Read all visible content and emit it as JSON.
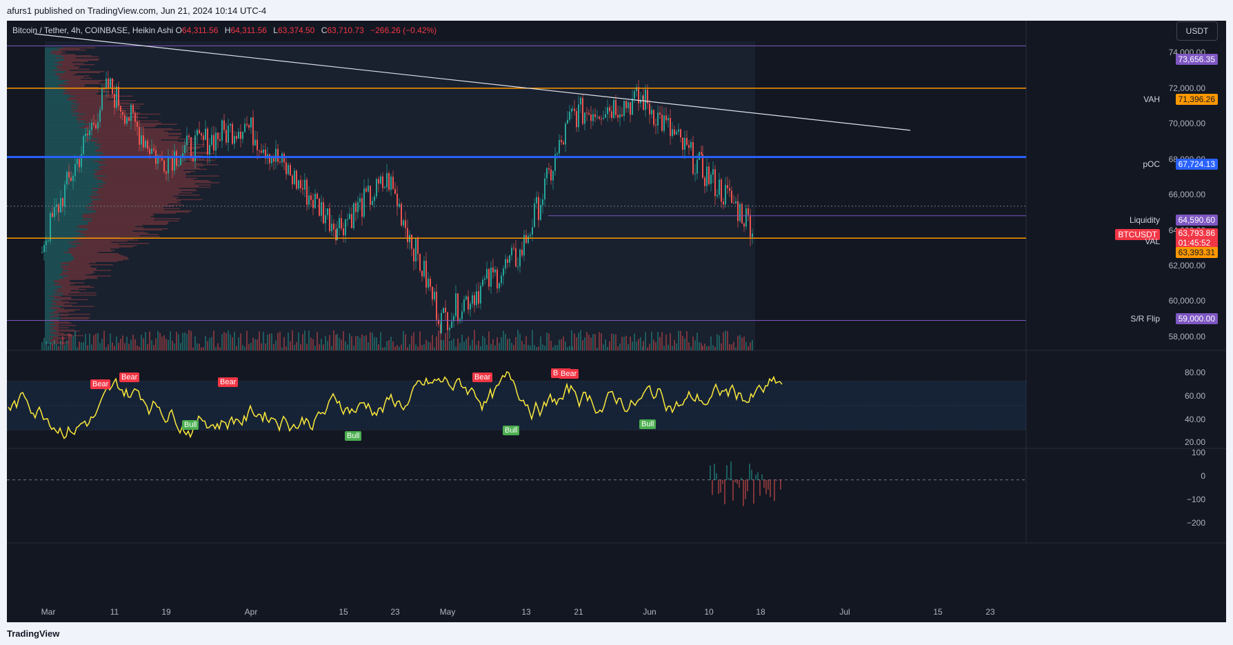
{
  "header": {
    "published": "afurs1 published on TradingView.com, Jun 21, 2024 10:14 UTC-4"
  },
  "legend": {
    "symbol": "Bitcoin / Tether, 4h, COINBASE, Heikin Ashi",
    "o_label": "O",
    "o": "64,311.56",
    "h_label": "H",
    "h": "64,311.56",
    "l_label": "L",
    "l": "63,374.50",
    "c_label": "C",
    "c": "63,710.73",
    "change": "−266.26 (−0.42%)"
  },
  "currency": "USDT",
  "levels": {
    "resistance_top": "73,656.35",
    "vah_label": "VAH",
    "vah": "71,396.26",
    "poc_label": "pOC",
    "poc": "67,724.13",
    "liquidity_label": "Liquidity",
    "liquidity": "64,590.60",
    "symbol_tag": "BTCUSDT",
    "last_price": "63,793.86",
    "countdown": "01:45:52",
    "val_label": "VAL",
    "val": "63,393.31",
    "sr_label": "S/R Flip",
    "sr": "59,000.00"
  },
  "colors": {
    "bg": "#131722",
    "up": "#26a69a",
    "down": "#ef5350",
    "vah": "#ff9800",
    "poc": "#2962ff",
    "purple": "#7e57c2",
    "osc": "#ffeb3b"
  },
  "price_axis": [
    "74,000.00",
    "72,000.00",
    "70,000.00",
    "68,000.00",
    "66,000.00",
    "64,000.00",
    "62,000.00",
    "60,000.00",
    "58,000.00"
  ],
  "osc_axis": [
    "80.00",
    "60.00",
    "40.00",
    "20.00"
  ],
  "cvd_axis": [
    "100",
    "0",
    "−100",
    "−200"
  ],
  "time_axis": [
    "Mar",
    "11",
    "19",
    "Apr",
    "15",
    "23",
    "May",
    "13",
    "21",
    "Jun",
    "10",
    "18",
    "Jul",
    "15",
    "23"
  ],
  "signals": {
    "bear": "Bear",
    "bull": "Bull"
  },
  "footer": {
    "brand": "TradingView"
  },
  "chart_data": {
    "type": "candlestick",
    "symbol": "BTCUSDT",
    "interval": "4h",
    "ylim": [
      57400,
      75000
    ],
    "x": [
      "Mar",
      "11",
      "19",
      "Apr",
      "15",
      "23",
      "May",
      "13",
      "21",
      "Jun",
      "10",
      "18",
      "Jul",
      "15",
      "23"
    ],
    "series": [
      {
        "name": "Bitcoin / Tether",
        "x": [
          "Mar",
          "11",
          "19",
          "Apr",
          "15",
          "23",
          "May",
          "13",
          "21",
          "Jun",
          "10",
          "18"
        ],
        "values": [
          63000,
          71500,
          67500,
          69500,
          64000,
          66500,
          59000,
          62500,
          70000,
          70800,
          67000,
          64000
        ]
      }
    ],
    "horizontal_levels": [
      73656.35,
      71396.26,
      67724.13,
      64590.6,
      63393.31,
      59000
    ],
    "osc_ylim": [
      15,
      95
    ],
    "cvd_ylim": [
      -220,
      110
    ]
  }
}
